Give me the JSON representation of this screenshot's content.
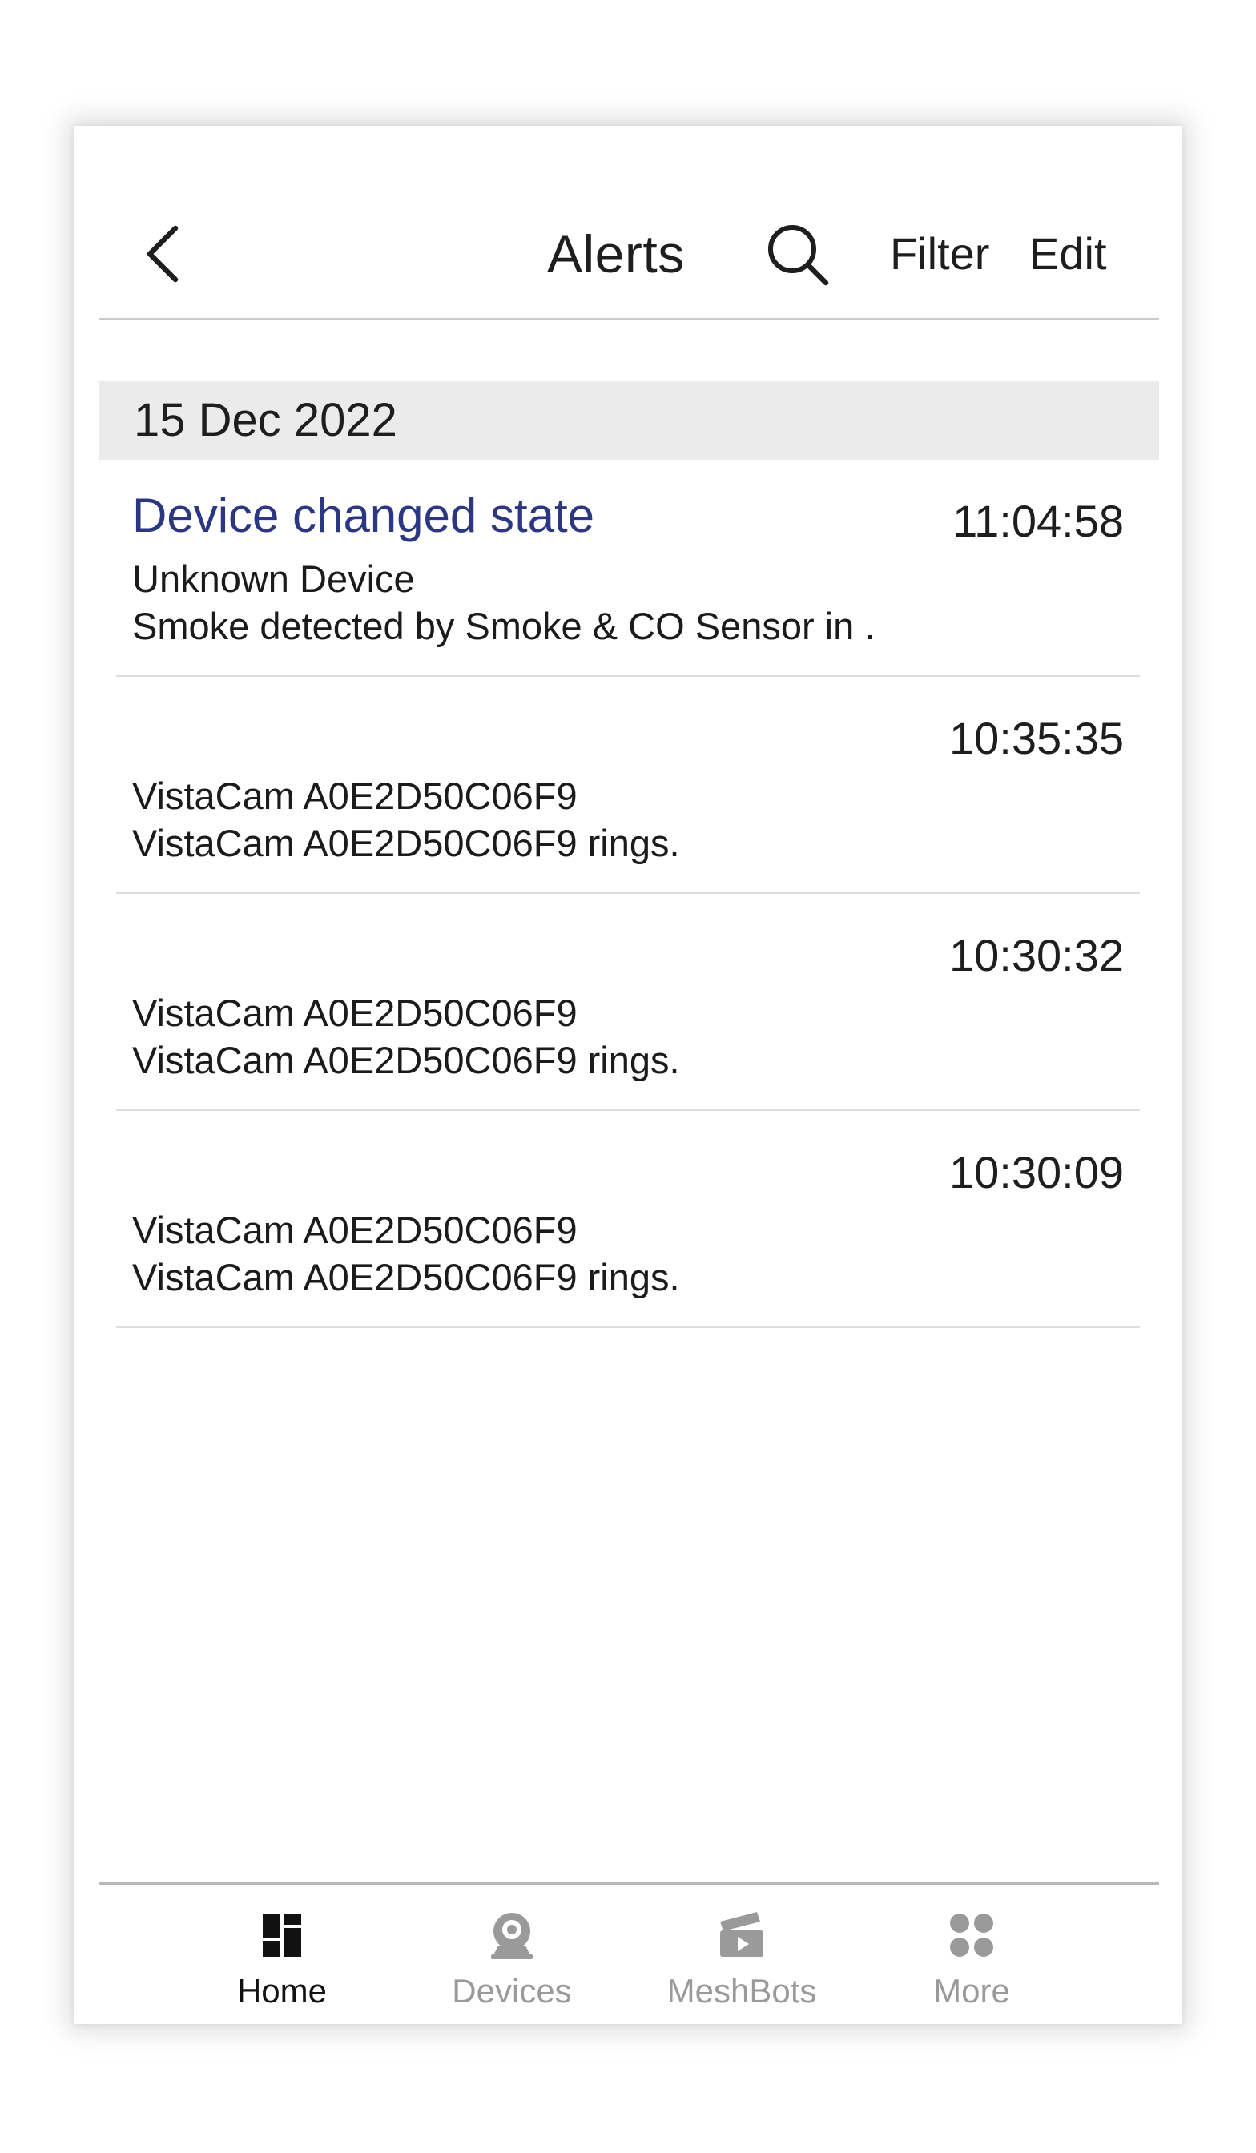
{
  "header": {
    "title": "Alerts",
    "filter_label": "Filter",
    "edit_label": "Edit"
  },
  "date_section": {
    "label": "15 Dec 2022"
  },
  "alerts": [
    {
      "title": "Device changed state",
      "time": "11:04:58",
      "device": "Unknown Device",
      "message": "Smoke detected by Smoke & CO Sensor in ."
    },
    {
      "title": "",
      "time": "10:35:35",
      "device": "VistaCam A0E2D50C06F9",
      "message": "VistaCam A0E2D50C06F9 rings."
    },
    {
      "title": "",
      "time": "10:30:32",
      "device": "VistaCam A0E2D50C06F9",
      "message": "VistaCam A0E2D50C06F9 rings."
    },
    {
      "title": "",
      "time": "10:30:09",
      "device": "VistaCam A0E2D50C06F9",
      "message": "VistaCam A0E2D50C06F9 rings."
    }
  ],
  "tabbar": {
    "items": [
      {
        "label": "Home",
        "icon": "home-dashboard-icon",
        "active": true
      },
      {
        "label": "Devices",
        "icon": "devices-camera-icon",
        "active": false
      },
      {
        "label": "MeshBots",
        "icon": "meshbots-clapper-icon",
        "active": false
      },
      {
        "label": "More",
        "icon": "more-dots-icon",
        "active": false
      }
    ]
  },
  "colors": {
    "alert_title": "#2b3782",
    "active_tab": "#111111",
    "inactive_tab": "#9a9a9a",
    "date_header_bg": "#ebebeb"
  }
}
